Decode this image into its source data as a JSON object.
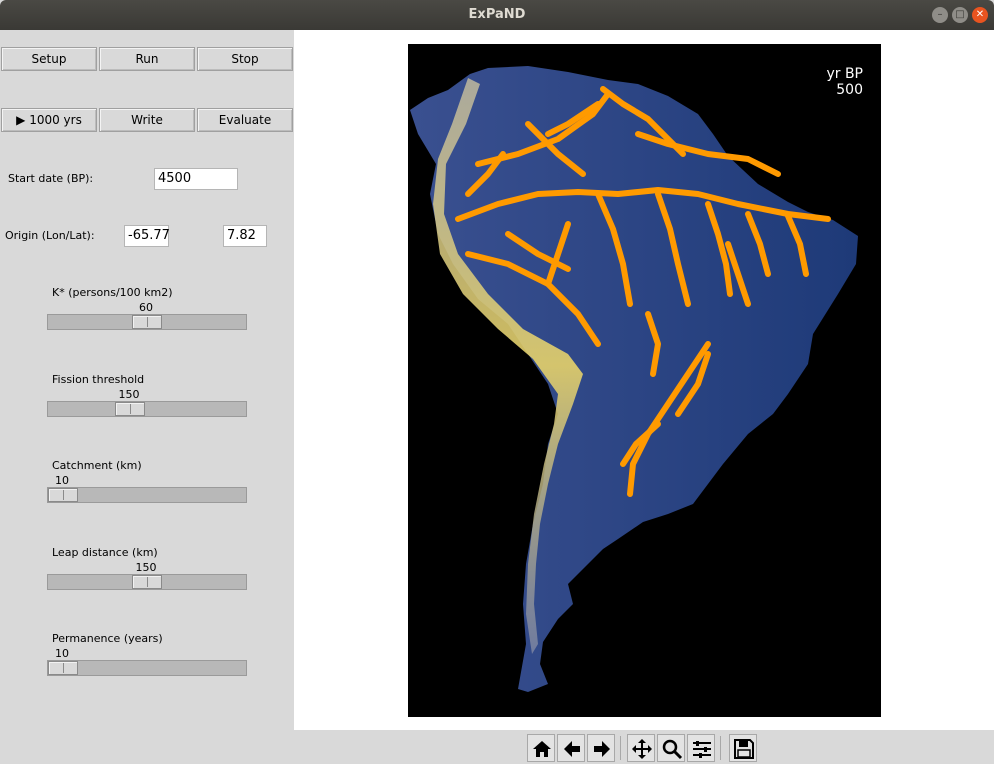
{
  "window": {
    "title": "ExPaND"
  },
  "controls": {
    "setup_label": "Setup",
    "run_label": "Run",
    "stop_label": "Stop",
    "step_label": "▶ 1000 yrs",
    "write_label": "Write",
    "evaluate_label": "Evaluate",
    "start_date_label": "Start date (BP):",
    "start_date_value": "4500",
    "origin_label": "Origin (Lon/Lat):",
    "origin_lon": "-65.77",
    "origin_lat": "7.82"
  },
  "sliders": [
    {
      "label": "K* (persons/100 km2)",
      "value": "60",
      "fraction": 0.5
    },
    {
      "label": "Fission threshold",
      "value": "150",
      "fraction": 0.4
    },
    {
      "label": "Catchment (km)",
      "value": "10",
      "fraction": 0.0
    },
    {
      "label": "Leap distance (km)",
      "value": "150",
      "fraction": 0.5
    },
    {
      "label": "Permanence (years)",
      "value": "10",
      "fraction": 0.0
    }
  ],
  "map": {
    "year_label": "yr BP",
    "year_value": "500",
    "colors": {
      "background": "#000000",
      "land_low": "#1e3a78",
      "land_high": "#d9c860",
      "settlement": "#ff9a00"
    }
  },
  "toolbar": {
    "icons": [
      "home-icon",
      "back-arrow-icon",
      "forward-arrow-icon",
      "pan-icon",
      "zoom-icon",
      "configure-subplots-icon",
      "save-icon"
    ]
  }
}
